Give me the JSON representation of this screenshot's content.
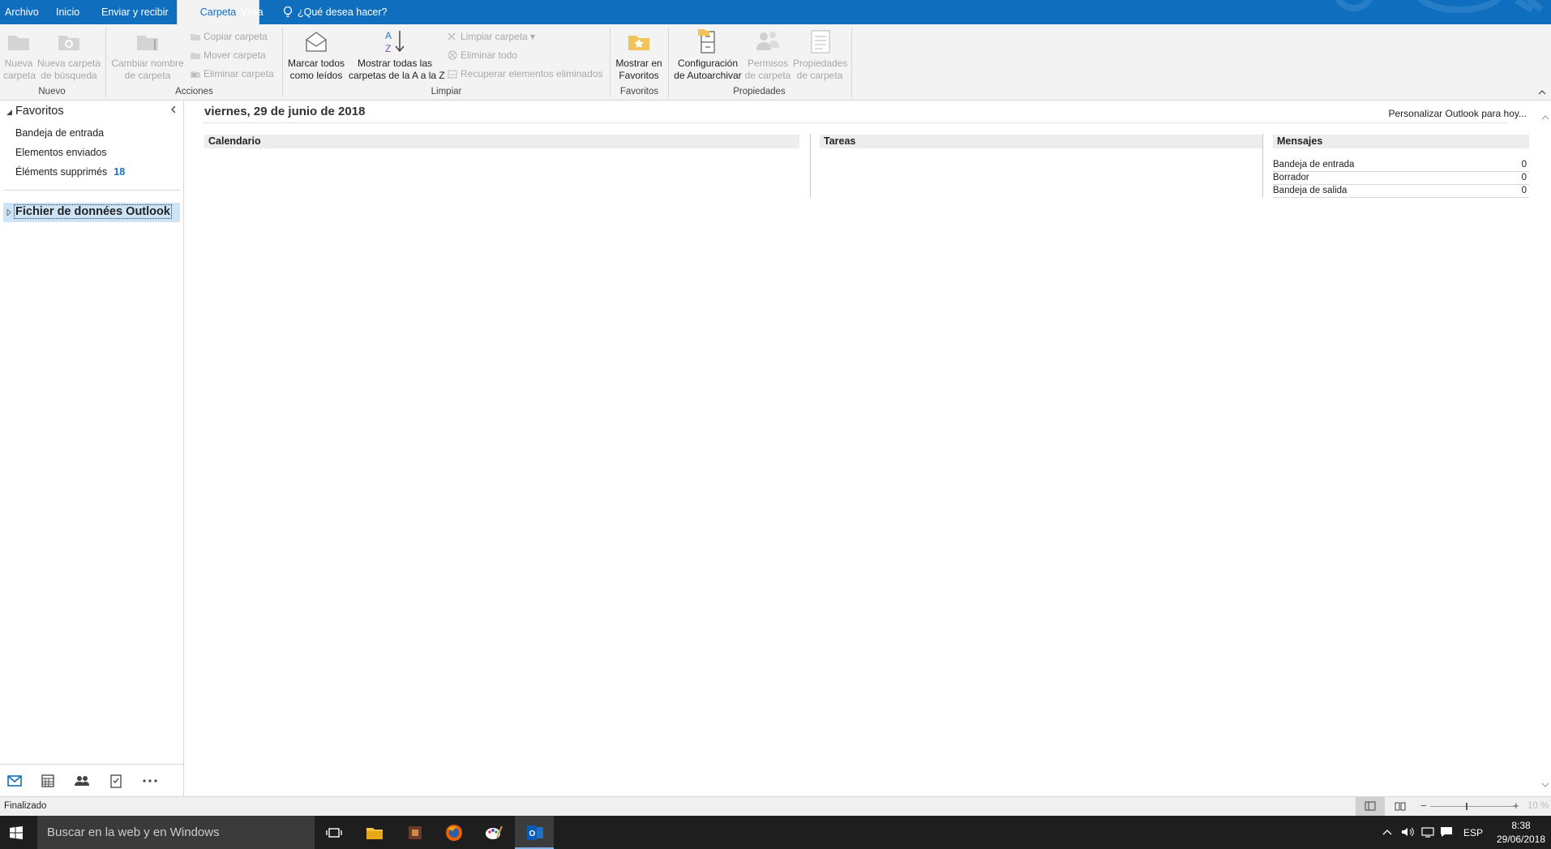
{
  "tabs": [
    "Archivo",
    "Inicio",
    "Enviar y recibir",
    "Carpeta",
    "Vista",
    "¿Qué desea hacer?"
  ],
  "ribbon": {
    "nueva_carpeta": [
      "Nueva",
      "carpeta"
    ],
    "nueva_busqueda": [
      "Nueva carpeta",
      "de búsqueda"
    ],
    "grupo_nuevo": "Nuevo",
    "cambiar_nombre": [
      "Cambiar nombre",
      "de carpeta"
    ],
    "copiar": "Copiar carpeta",
    "mover": "Mover carpeta",
    "eliminar_carpeta": "Eliminar carpeta",
    "grupo_acciones": "Acciones",
    "marcar": [
      "Marcar todos",
      "como leídos"
    ],
    "mostrar_az": [
      "Mostrar todas las",
      "carpetas de la A a la Z"
    ],
    "limpiar_carpeta": "Limpiar carpeta",
    "eliminar_todo": "Eliminar todo",
    "recuperar": "Recuperar elementos eliminados",
    "grupo_limpiar": "Limpiar",
    "mostrar_favoritos": [
      "Mostrar en",
      "Favoritos"
    ],
    "grupo_favoritos": "Favoritos",
    "autoarchivar": [
      "Configuración",
      "de Autoarchivar"
    ],
    "permisos": [
      "Permisos",
      "de carpeta"
    ],
    "propiedades": [
      "Propiedades",
      "de carpeta"
    ],
    "grupo_propiedades": "Propiedades"
  },
  "nav": {
    "favoritos": "Favoritos",
    "items": [
      {
        "label": "Bandeja de entrada",
        "count": ""
      },
      {
        "label": "Elementos enviados",
        "count": ""
      },
      {
        "label": "Éléments supprimés",
        "count": "18"
      }
    ],
    "datafile": "Fichier de données Outlook"
  },
  "main": {
    "date": "viernes, 29 de junio de 2018",
    "personalizar": "Personalizar Outlook para hoy...",
    "calendario": "Calendario",
    "tareas": "Tareas",
    "mensajes": "Mensajes",
    "msg_rows": [
      {
        "label": "Bandeja de entrada",
        "value": "0"
      },
      {
        "label": "Borrador",
        "value": "0"
      },
      {
        "label": "Bandeja de salida",
        "value": "0"
      }
    ]
  },
  "status": {
    "text": "Finalizado",
    "zoom": "10 %"
  },
  "taskbar": {
    "search": "Buscar en la web y en Windows",
    "lang": "ESP",
    "time": "8:38",
    "date": "29/06/2018"
  },
  "colors": {
    "accent": "#106ebe",
    "count": "#1a6dc0",
    "selection": "#cde4f7"
  }
}
